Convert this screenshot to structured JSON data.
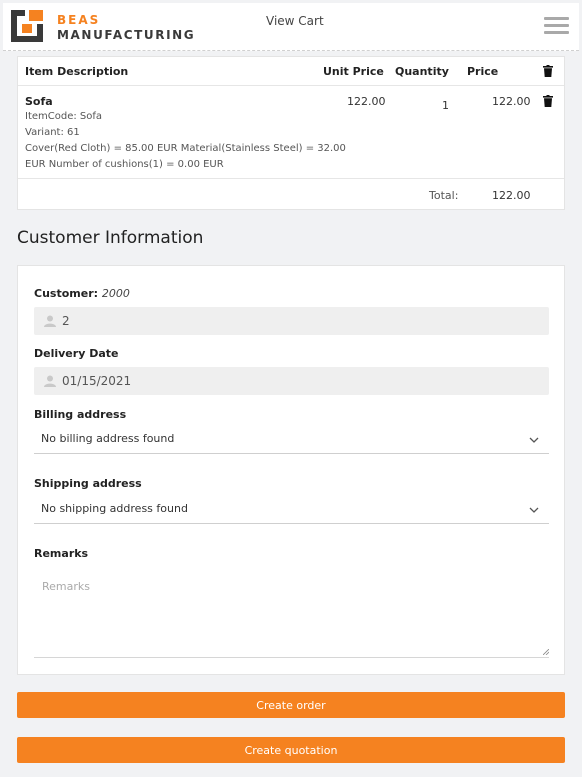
{
  "brand": {
    "line1": "BEAS",
    "line2": "MANUFACTURING",
    "accent": "#f58220"
  },
  "nav": {
    "view_cart": "View Cart",
    "menu_icon": "hamburger-menu-icon"
  },
  "cart": {
    "headers": {
      "description": "Item Description",
      "unit_price": "Unit Price",
      "quantity": "Quantity",
      "price": "Price"
    },
    "items": [
      {
        "name": "Sofa",
        "details": [
          "ItemCode: Sofa",
          "Variant: 61",
          "Cover(Red Cloth) = 85.00 EUR Material(Stainless Steel) = 32.00",
          "EUR Number of cushions(1) = 0.00 EUR"
        ],
        "unit_price": "122.00",
        "quantity": "1",
        "price": "122.00"
      }
    ],
    "total_label": "Total:",
    "total_value": "122.00"
  },
  "customer_section": {
    "title": "Customer Information",
    "customer_label": "Customer:",
    "customer_code": "2000",
    "customer_value": "2",
    "delivery_label": "Delivery Date",
    "delivery_value": "01/15/2021",
    "billing_label": "Billing address",
    "billing_value": "No billing address found",
    "shipping_label": "Shipping address",
    "shipping_value": "No shipping address found",
    "remarks_label": "Remarks",
    "remarks_placeholder": "Remarks"
  },
  "actions": {
    "create_order": "Create order",
    "create_quotation": "Create quotation"
  }
}
